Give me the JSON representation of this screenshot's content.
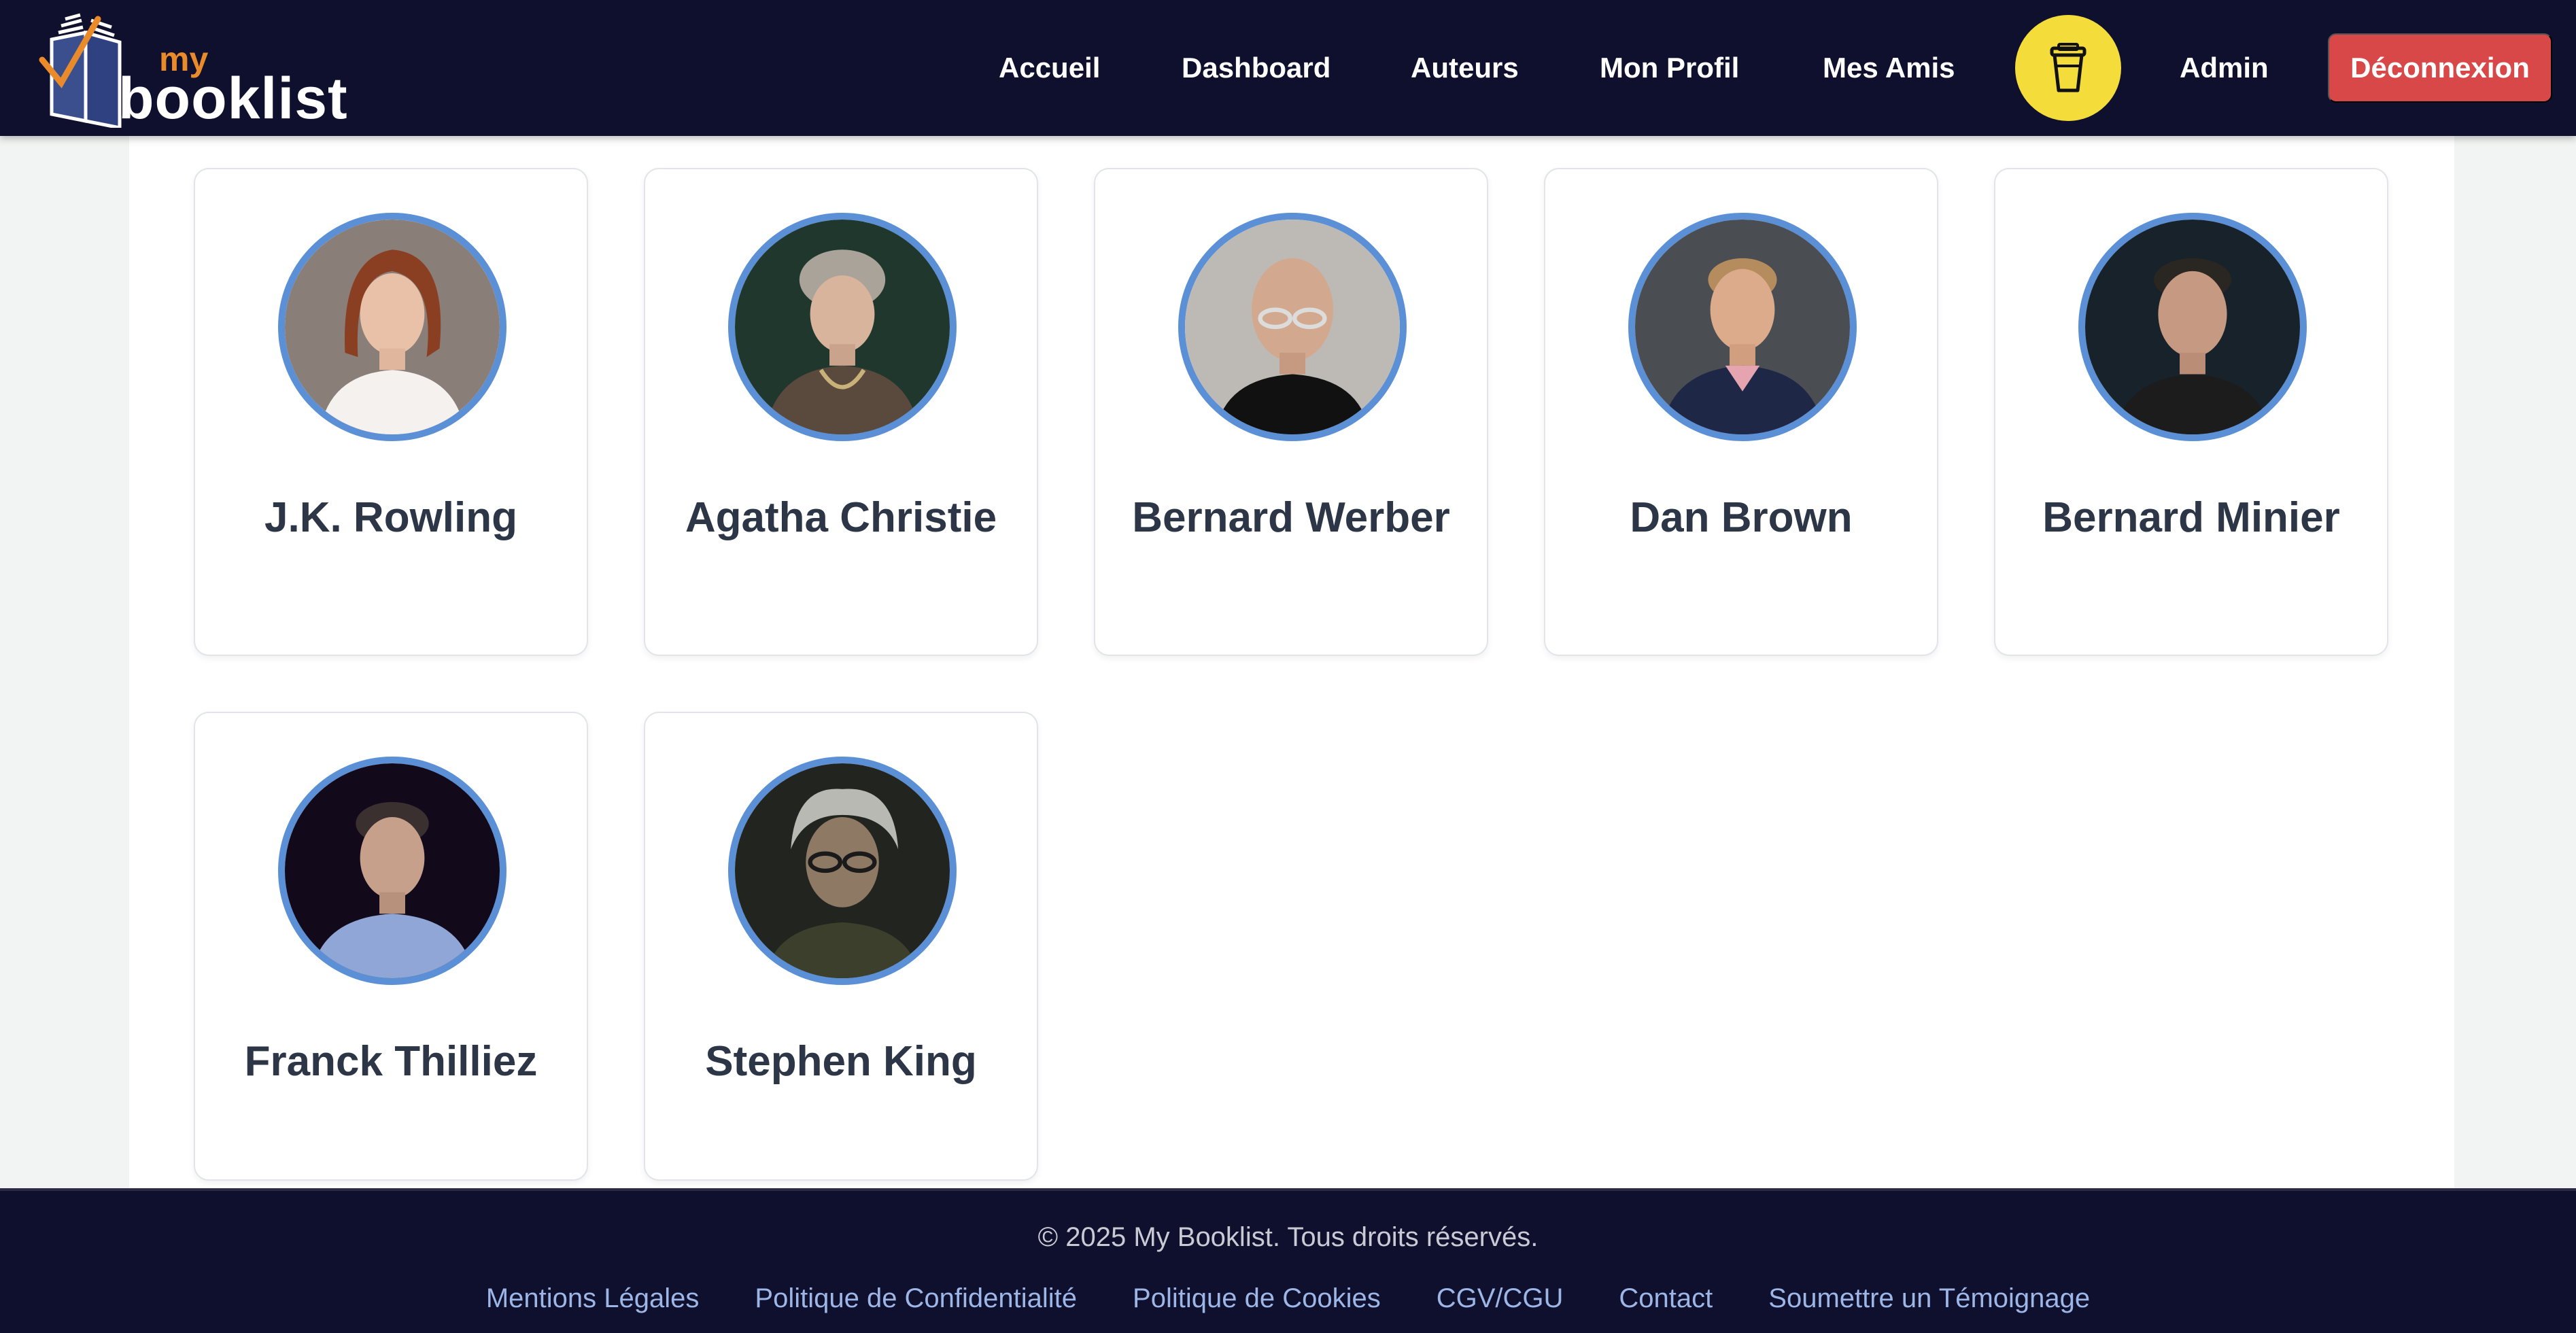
{
  "brand": {
    "prefix": "my",
    "name": "booklist"
  },
  "nav": {
    "links": [
      {
        "label": "Accueil"
      },
      {
        "label": "Dashboard"
      },
      {
        "label": "Auteurs"
      },
      {
        "label": "Mon Profil"
      },
      {
        "label": "Mes Amis"
      }
    ],
    "coffee_icon": "coffee-cup-icon",
    "admin_label": "Admin",
    "logout_label": "Déconnexion"
  },
  "colors": {
    "navbar_bg": "#0f0f2e",
    "accent_yellow": "#f4dd3a",
    "logout_red": "#d84848",
    "avatar_border": "#5b8fd6",
    "author_name": "#2c3646",
    "footer_link": "#9db6e6"
  },
  "authors": [
    {
      "name": "J.K. Rowling"
    },
    {
      "name": "Agatha Christie"
    },
    {
      "name": "Bernard Werber"
    },
    {
      "name": "Dan Brown"
    },
    {
      "name": "Bernard Minier"
    },
    {
      "name": "Franck Thilliez"
    },
    {
      "name": "Stephen King"
    }
  ],
  "footer": {
    "copyright": "© 2025 My Booklist. Tous droits réservés.",
    "links": [
      {
        "label": "Mentions Légales"
      },
      {
        "label": "Politique de Confidentialité"
      },
      {
        "label": "Politique de Cookies"
      },
      {
        "label": "CGV/CGU"
      },
      {
        "label": "Contact"
      },
      {
        "label": "Soumettre un Témoignage"
      }
    ]
  }
}
